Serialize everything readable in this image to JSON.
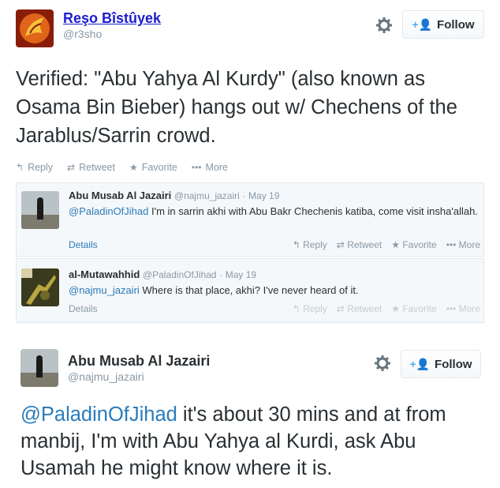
{
  "tweet1": {
    "author_name": "Reşo Bîstûyek",
    "author_handle": "@r3sho",
    "follow_label": "Follow",
    "text": "Verified: \"Abu Yahya Al Kurdy\" (also known as Osama Bin Bieber) hangs out w/ Chechens of the Jarablus/Sarrin crowd.",
    "actions": {
      "reply": "Reply",
      "retweet": "Retweet",
      "favorite": "Favorite",
      "more": "More"
    }
  },
  "replies": [
    {
      "name": "Abu Musab Al Jazairi",
      "handle": "@najmu_jazairi",
      "date": "May 19",
      "mention": "@PaladinOfJihad",
      "text": " I'm in sarrin akhi with Abu Bakr Chechenis katiba, come visit insha'allah.",
      "details": "Details",
      "actions": {
        "reply": "Reply",
        "retweet": "Retweet",
        "favorite": "Favorite",
        "more": "More"
      }
    },
    {
      "name": "al-Mutawahhid",
      "handle": "@PaladinOfJihad",
      "date": "May 19",
      "mention": "@najmu_jazairi",
      "text": " Where is that place, akhi? I've never heard of it.",
      "details": "Details",
      "actions": {
        "reply": "Reply",
        "retweet": "Retweet",
        "favorite": "Favorite",
        "more": "More"
      }
    }
  ],
  "tweet2": {
    "author_name": "Abu Musab Al Jazairi",
    "author_handle": "@najmu_jazairi",
    "follow_label": "Follow",
    "mention": "@PaladinOfJihad",
    "text": " it's about 30 mins and at from manbij, I'm with Abu Yahya al Kurdi, ask Abu Usamah he might know where it is."
  },
  "icons": {
    "settings": "gear-icon",
    "follow": "add-user-icon",
    "reply": "reply-arrow-icon",
    "retweet": "retweet-icon",
    "favorite": "star-icon",
    "more": "ellipsis-icon"
  },
  "colors": {
    "link": "#2b7bb9",
    "muted": "#8899a6",
    "text": "#292f33",
    "author_link": "#1c1ccf"
  }
}
